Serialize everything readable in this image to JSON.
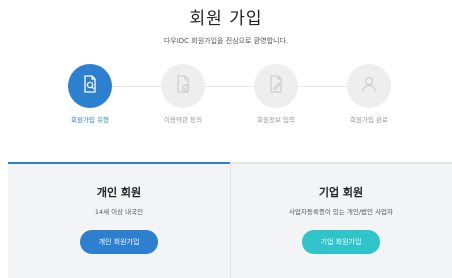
{
  "header": {
    "title": "회원 가입",
    "subtitle": "다우IDC 회원가입을 진심으로 환영합니다."
  },
  "steps": [
    {
      "label": "회원가입 유형",
      "icon": "document-search-icon",
      "active": true
    },
    {
      "label": "이용약관 동의",
      "icon": "document-check-icon",
      "active": false
    },
    {
      "label": "회원정보 입력",
      "icon": "document-edit-icon",
      "active": false
    },
    {
      "label": "회원가입 완료",
      "icon": "user-icon",
      "active": false
    }
  ],
  "cards": {
    "personal": {
      "title": "개인 회원",
      "description": "14세 이상 내국인",
      "button_label": "개인 회원가입"
    },
    "business": {
      "title": "기업 회원",
      "description": "사업자등록증이 있는 개인/법인 사업자",
      "button_label": "기업 회원가입"
    }
  },
  "colors": {
    "primary": "#2d7fcf",
    "secondary": "#2ec4c9",
    "inactive_step": "#eeeeee",
    "inactive_icon": "#cfcfcf",
    "panel_background": "#f3f4f6"
  }
}
